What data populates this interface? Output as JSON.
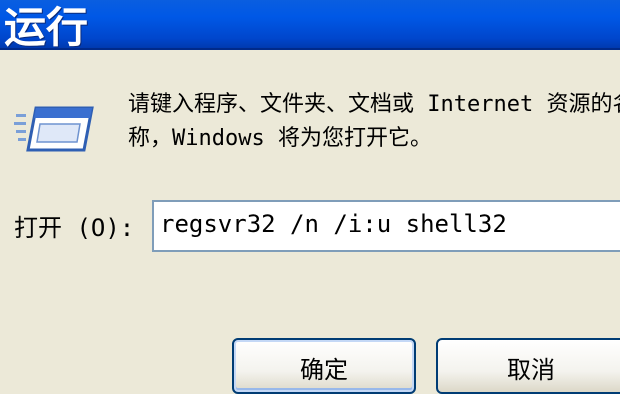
{
  "window": {
    "title": "运行"
  },
  "dialog": {
    "description_line1": "请键入程序、文件夹、文档或 Internet 资源的名",
    "description_line2": "称，Windows 将为您打开它。",
    "open_label": "打开",
    "open_accel": "(O):",
    "command_value": "regsvr32 /n /i:u shell32",
    "icon": "run-program-icon"
  },
  "buttons": {
    "ok_label": "确定",
    "cancel_label": "取消"
  },
  "colors": {
    "titlebar": "#0058e6",
    "dialog_bg": "#ece9d8",
    "input_border": "#7f9db9",
    "button_border": "#003c74"
  }
}
